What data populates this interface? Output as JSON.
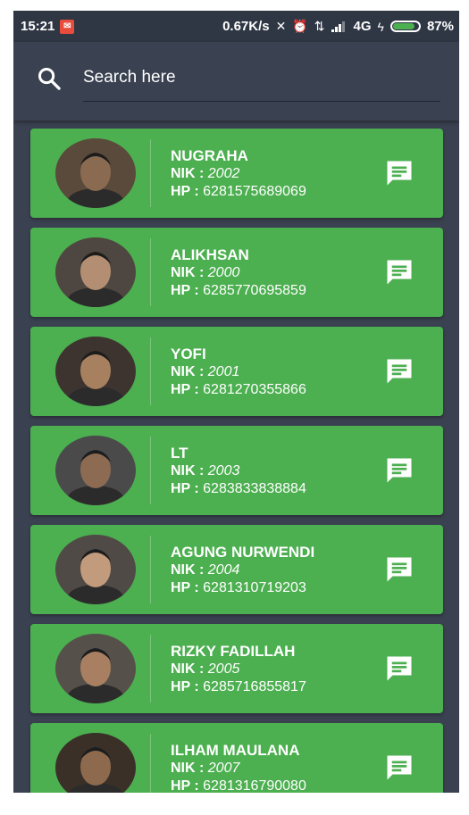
{
  "status_bar": {
    "time": "15:21",
    "notification_icon": "app-notification-icon",
    "speed": "0.67K/s",
    "network": "4G",
    "battery": "87%",
    "battery_level": 0.87
  },
  "search": {
    "placeholder": "Search here",
    "icon": "search-icon"
  },
  "colors": {
    "card": "#4caf50",
    "background": "#3a4150",
    "status_bar": "#2f3644"
  },
  "labels": {
    "nik": "NIK : ",
    "hp": "HP : "
  },
  "contacts": [
    {
      "name": "NUGRAHA",
      "nik": "2002",
      "hp": "6281575689069"
    },
    {
      "name": "ALIKHSAN",
      "nik": "2000",
      "hp": "6285770695859"
    },
    {
      "name": "YOFI",
      "nik": "2001",
      "hp": "6281270355866"
    },
    {
      "name": "LT",
      "nik": "2003",
      "hp": "6283833838884"
    },
    {
      "name": "AGUNG NURWENDI",
      "nik": "2004",
      "hp": "6281310719203"
    },
    {
      "name": "RIZKY FADILLAH",
      "nik": "2005",
      "hp": "6285716855817"
    },
    {
      "name": "ILHAM MAULANA",
      "nik": "2007",
      "hp": "6281316790080"
    }
  ]
}
